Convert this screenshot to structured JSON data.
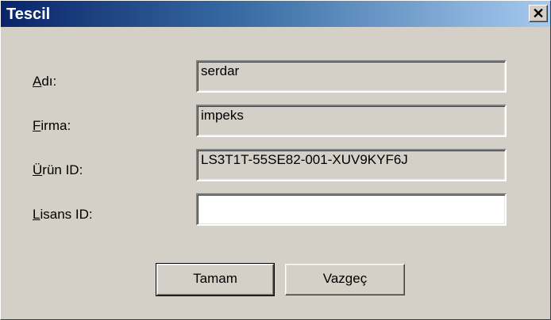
{
  "window": {
    "title": "Tescil",
    "close_glyph": "✕"
  },
  "fields": {
    "adi": {
      "label_accel": "A",
      "label_rest": "dı:",
      "value": "serdar"
    },
    "firma": {
      "label_accel": "F",
      "label_rest": "irma:",
      "value": "impeks"
    },
    "urun_id": {
      "label_accel": "Ü",
      "label_rest": "rün ID:",
      "value": "LS3T1T-55SE82-001-XUV9KYF6J"
    },
    "lisans_id": {
      "label_accel": "L",
      "label_rest": "isans ID:",
      "value": ""
    }
  },
  "buttons": {
    "ok_label": "Tamam",
    "cancel_label": "Vazgeç"
  },
  "colors": {
    "title_gradient_start": "#0a246a",
    "title_gradient_end": "#a6caf0",
    "dialog_face": "#d4d0c8"
  },
  "icons": {
    "close": "close-icon"
  }
}
